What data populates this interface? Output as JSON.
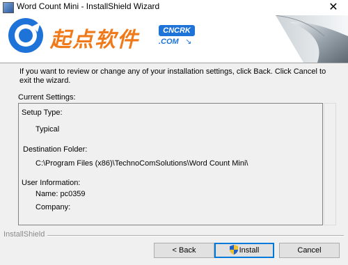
{
  "window": {
    "title": "Word Count Mini - InstallShield Wizard",
    "close_glyph": "✕"
  },
  "banner": {
    "brand_text": "起点软件",
    "badge_text": "CNCRK",
    "domain_text": ".COM",
    "arrow_glyph": "↘",
    "logo_icon": "refresh-circle-logo",
    "brand_color": "#f07a1a",
    "accent_color": "#1e73d8"
  },
  "intro": {
    "text": "If you want to review or change any of your installation settings, click Back. Click Cancel to exit the wizard."
  },
  "current_settings": {
    "label": "Current Settings:",
    "setup_type_label": "Setup Type:",
    "setup_type_value": "Typical",
    "destination_label": "Destination Folder:",
    "destination_value": "C:\\Program Files (x86)\\TechnoComSolutions\\Word Count Mini\\",
    "user_info_label": "User Information:",
    "name_line": "Name: pc0359",
    "company_line": "Company:"
  },
  "footer": {
    "brand": "InstallShield"
  },
  "buttons": {
    "back": "< Back",
    "install": "Install",
    "cancel": "Cancel",
    "install_icon": "uac-shield-icon"
  }
}
